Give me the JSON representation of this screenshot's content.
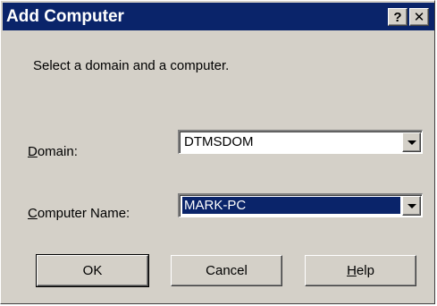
{
  "window": {
    "title": "Add Computer",
    "help_glyph": "?",
    "close_glyph": "✕"
  },
  "instruction": "Select a domain and a computer.",
  "domain": {
    "label_accel": "D",
    "label_rest": "omain:",
    "value": "DTMSDOM"
  },
  "computer": {
    "label_accel": "C",
    "label_rest": "omputer Name:",
    "value": "MARK-PC"
  },
  "buttons": {
    "ok": "OK",
    "cancel": "Cancel",
    "help_accel": "H",
    "help_rest": "elp"
  },
  "colors": {
    "titlebar": "#0a246a",
    "dialog_face": "#d4d0c8",
    "selection": "#0a246a"
  }
}
